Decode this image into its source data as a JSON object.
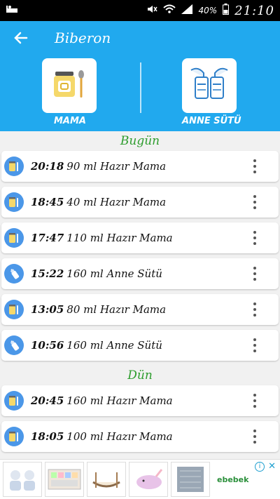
{
  "status": {
    "battery": "40%",
    "time": "21:10"
  },
  "appbar": {
    "title": "Biberon"
  },
  "categories": [
    {
      "label": "MAMA",
      "icon": "baby-food-jar-spoon-icon"
    },
    {
      "label": "ANNE SÜTÜ",
      "icon": "breast-pump-bottles-icon"
    }
  ],
  "sections": [
    {
      "title": "Bugün",
      "rows": [
        {
          "time": "20:18",
          "text": "90 ml Hazır Mama",
          "icon": "jar-icon"
        },
        {
          "time": "18:45",
          "text": "40 ml Hazır Mama",
          "icon": "jar-icon"
        },
        {
          "time": "17:47",
          "text": "110 ml Hazır Mama",
          "icon": "jar-icon"
        },
        {
          "time": "15:22",
          "text": "160 ml Anne Sütü",
          "icon": "bottle-icon"
        },
        {
          "time": "13:05",
          "text": "80 ml Hazır Mama",
          "icon": "jar-icon"
        },
        {
          "time": "10:56",
          "text": "160 ml Anne Sütü",
          "icon": "bottle-icon"
        }
      ]
    },
    {
      "title": "Dün",
      "rows": [
        {
          "time": "20:45",
          "text": "160 ml Hazır Mama",
          "icon": "jar-icon"
        },
        {
          "time": "18:05",
          "text": "100 ml Hazır Mama",
          "icon": "jar-icon"
        }
      ]
    }
  ],
  "ad": {
    "brand": "ebebek"
  },
  "colors": {
    "primary": "#21a9ee",
    "sectionTitle": "#2e9d2e",
    "rowIcon": "#4b97e8"
  }
}
